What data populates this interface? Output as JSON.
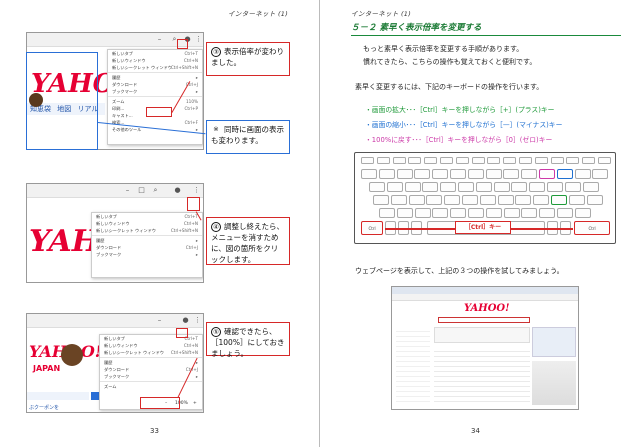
{
  "left_page": {
    "header": "インターネット (1)",
    "page_number": "33",
    "shot1": {
      "menu_items": [
        {
          "label": "新しいタブ",
          "shortcut": "Ctrl+T"
        },
        {
          "label": "新しいウィンドウ",
          "shortcut": "Ctrl+N"
        },
        {
          "label": "新しいシークレット ウィンドウ",
          "shortcut": "Ctrl+Shift+N"
        },
        {
          "label": "履歴",
          "shortcut": "▸"
        },
        {
          "label": "ダウンロード",
          "shortcut": "Ctrl+J"
        },
        {
          "label": "ブックマーク",
          "shortcut": "▸"
        },
        {
          "label": "ズーム",
          "shortcut": "110%"
        },
        {
          "label": "印刷...",
          "shortcut": "Ctrl+P"
        },
        {
          "label": "キャスト...",
          "shortcut": ""
        },
        {
          "label": "検索...",
          "shortcut": "Ctrl+F"
        },
        {
          "label": "その他のツール",
          "shortcut": "▸"
        }
      ],
      "zoom_value": "110%",
      "page_links": [
        "知恵袋",
        "地図",
        "リアル"
      ]
    },
    "callout1": {
      "num": "③",
      "text": "表示倍率が変わりました。"
    },
    "callout_note": {
      "num": "※",
      "text": "同時に画面の表示も変わります。"
    },
    "shot2": {
      "menu_items": [
        {
          "label": "新しいタブ",
          "shortcut": "Ctrl+T"
        },
        {
          "label": "新しいウィンドウ",
          "shortcut": "Ctrl+N"
        },
        {
          "label": "新しいシークレット ウィンドウ",
          "shortcut": "Ctrl+Shift+N"
        },
        {
          "label": "履歴",
          "shortcut": "▸"
        },
        {
          "label": "ダウンロード",
          "shortcut": "Ctrl+J"
        },
        {
          "label": "ブックマーク",
          "shortcut": "▸"
        }
      ]
    },
    "callout2": {
      "num": "④",
      "text": "調整し終えたら、メニューを消すために、図の箇所をクリックします。"
    },
    "shot3": {
      "menu_items": [
        {
          "label": "新しいタブ",
          "shortcut": "Ctrl+T"
        },
        {
          "label": "新しいウィンドウ",
          "shortcut": "Ctrl+N"
        },
        {
          "label": "新しいシークレット ウィンドウ",
          "shortcut": "Ctrl+Shift+N"
        },
        {
          "label": "履歴",
          "shortcut": "▸"
        },
        {
          "label": "ダウンロード",
          "shortcut": "Ctrl+J"
        },
        {
          "label": "ブックマーク",
          "shortcut": "▸"
        },
        {
          "label": "ズーム",
          "shortcut": ""
        }
      ],
      "zoom_minus": "–",
      "zoom_value": "100%",
      "zoom_plus": "+",
      "page_text": "JAPAN",
      "bottom_link": "ぶクーポンを"
    },
    "callout3": {
      "num": "⑤",
      "text": "確認できたら、［100%］にしておきましょう。"
    },
    "brand_text": "YAHOO!"
  },
  "right_page": {
    "header": "インターネット (1)",
    "page_number": "34",
    "title": "５－２ 素早く表示倍率を変更する",
    "intro_lines": [
      "もっと素早く表示倍率を変更する手順があります。",
      "慣れてきたら、こちらの操作も覚えておくと便利です。"
    ],
    "lead": "素早く変更するには、下記のキーボードの操作を行います。",
    "shortcuts": [
      {
        "label": "・画面の拡大･･･［Ctrl］キーを押しながら［+］(プラス)キー",
        "color": "#1f9a3a"
      },
      {
        "label": "・画面の縮小･･･［Ctrl］キーを押しながら［—］(マイナス)キー",
        "color": "#1e6fd0"
      },
      {
        "label": "・100%に戻す･･･［Ctrl］キーを押しながら［0］(ゼロ)キー",
        "color": "#cc3aa8"
      }
    ],
    "keyboard": {
      "ctrl_label": "［Ctrl］キー",
      "ctrl_key": "Ctrl"
    },
    "outro": "ウェブページを表示して、上記の３つの操作を試してみましょう。",
    "browser_brand": "YAHOO!"
  }
}
